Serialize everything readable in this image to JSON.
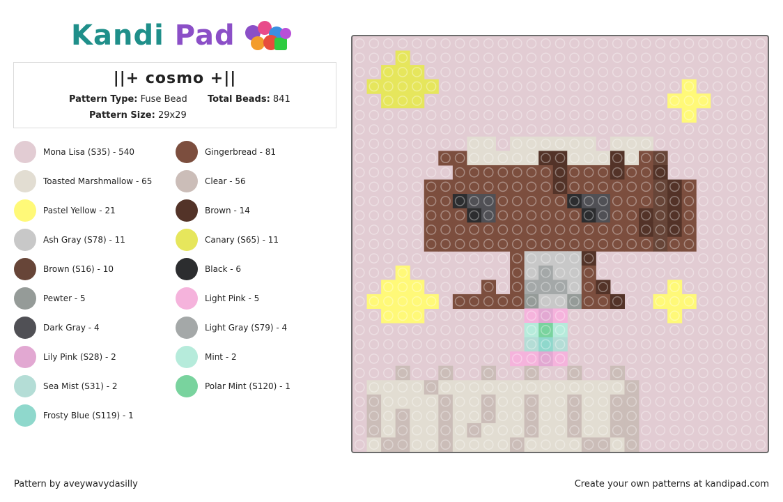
{
  "header": {
    "logo_text_1": "Kandi",
    "logo_text_2": "Pad",
    "logo_icon": "beads-pile-icon"
  },
  "pattern": {
    "title": "||+ cosmo +||",
    "type_label": "Pattern Type:",
    "type_value": "Fuse Bead",
    "beads_label": "Total Beads:",
    "beads_value": "841",
    "size_label": "Pattern Size:",
    "size_value": "29x29"
  },
  "legend": [
    {
      "label": "Mona Lisa (S35) - 540",
      "color": "#e2ccd3"
    },
    {
      "label": "Gingerbread - 81",
      "color": "#7c4e3e"
    },
    {
      "label": "Toasted Marshmallow - 65",
      "color": "#e2ddd2"
    },
    {
      "label": "Clear - 56",
      "color": "#cbbdb8"
    },
    {
      "label": "Pastel Yellow - 21",
      "color": "#fff978"
    },
    {
      "label": "Brown - 14",
      "color": "#533328"
    },
    {
      "label": "Ash Gray (S78) - 11",
      "color": "#c8c8c8"
    },
    {
      "label": "Canary (S65) - 11",
      "color": "#e6e65c"
    },
    {
      "label": "Brown (S16) - 10",
      "color": "#674538"
    },
    {
      "label": "Black - 6",
      "color": "#2c2d2f"
    },
    {
      "label": "Pewter - 5",
      "color": "#959b98"
    },
    {
      "label": "Light Pink - 5",
      "color": "#f5b3dc"
    },
    {
      "label": "Dark Gray - 4",
      "color": "#505055"
    },
    {
      "label": "Light Gray (S79) - 4",
      "color": "#a4a8a8"
    },
    {
      "label": "Lily Pink (S28) - 2",
      "color": "#e2a8d2"
    },
    {
      "label": "Mint - 2",
      "color": "#b6ebdb"
    },
    {
      "label": "Sea Mist (S31) - 2",
      "color": "#b4ddd6"
    },
    {
      "label": "Polar Mint (S120) - 1",
      "color": "#79d39e"
    },
    {
      "label": "Frosty Blue (S119) - 1",
      "color": "#8fd8cc"
    }
  ],
  "board": {
    "background": "#e2ccd3",
    "grid": 29
  },
  "footer": {
    "credit": "Pattern by aveywavydasilly",
    "cta": "Create your own patterns at kandipad.com"
  }
}
